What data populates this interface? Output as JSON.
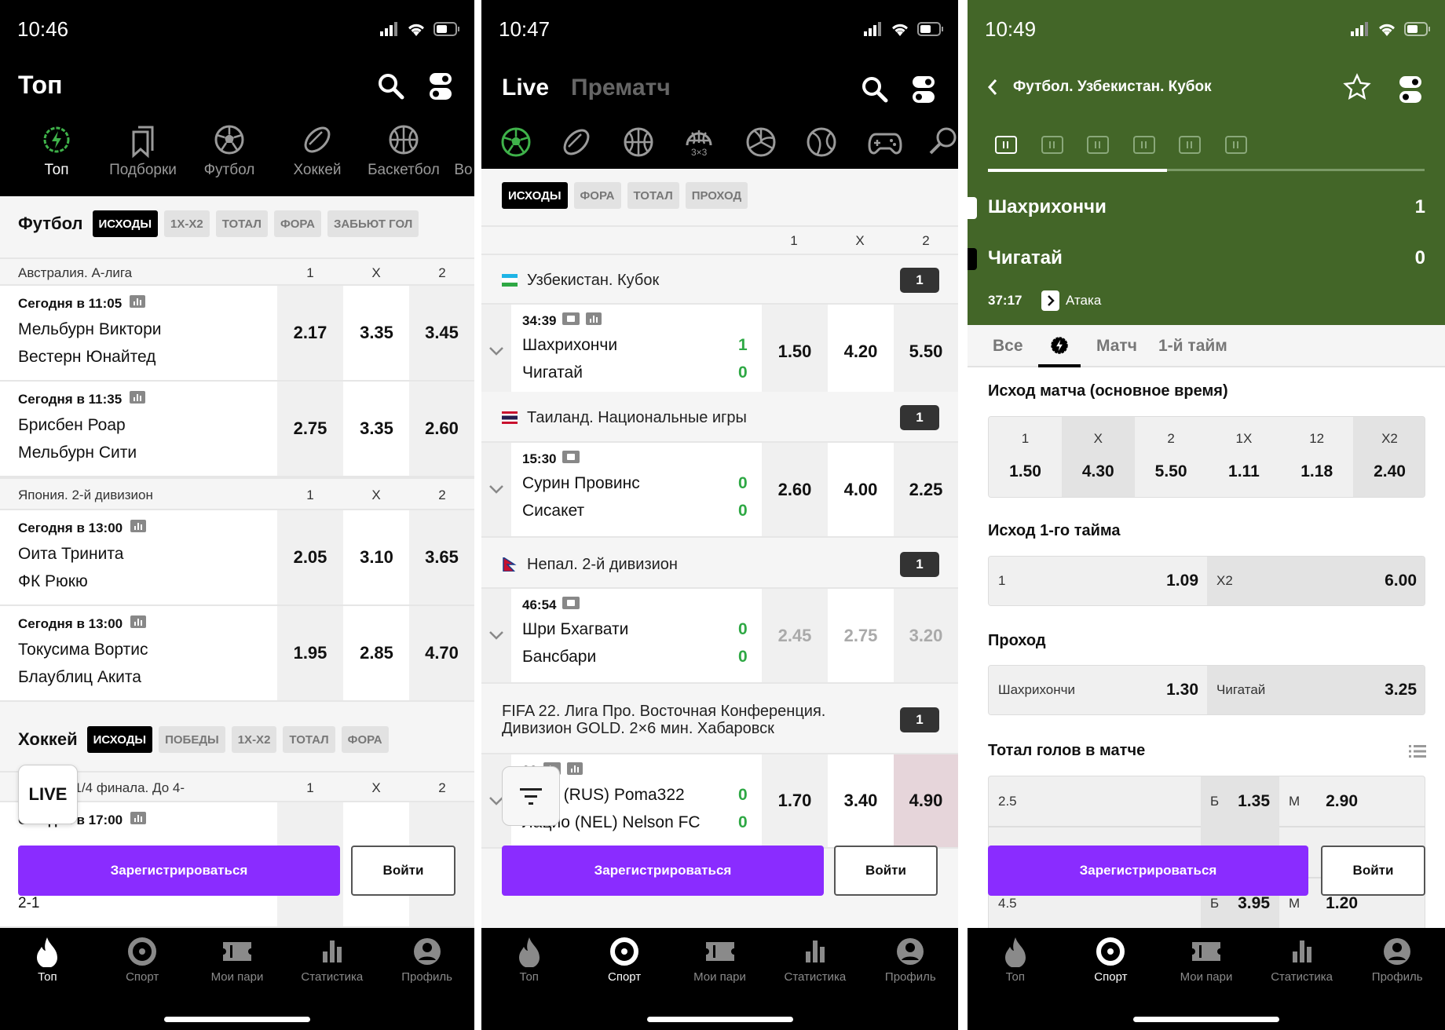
{
  "colors": {
    "accent_green": "#3fb24a",
    "header_green": "#436628",
    "register_purple": "#8a2cff",
    "dark": "#000000",
    "score_green": "#2ea844",
    "suspended_gray": "#aaaaaa",
    "highlight_pink": "#e6d5da"
  },
  "nav": [
    {
      "label": "Топ",
      "icon": "flame-icon"
    },
    {
      "label": "Спорт",
      "icon": "target-icon"
    },
    {
      "label": "Мои пари",
      "icon": "ticket-icon"
    },
    {
      "label": "Статистика",
      "icon": "bar-chart-icon"
    },
    {
      "label": "Профиль",
      "icon": "user-icon"
    }
  ],
  "left": {
    "status_time": "10:46",
    "title": "Топ",
    "categories": [
      {
        "label": "Топ",
        "icon": "lightning-badge-icon",
        "active": true
      },
      {
        "label": "Подборки",
        "icon": "bookmarks-icon"
      },
      {
        "label": "Футбол",
        "icon": "soccer-ball-icon"
      },
      {
        "label": "Хоккей",
        "icon": "hockey-puck-icon"
      },
      {
        "label": "Баскетбол",
        "icon": "basketball-icon"
      },
      {
        "label": "Во",
        "icon": "sport-icon"
      }
    ],
    "football": {
      "title": "Футбол",
      "chips": [
        "ИСХОДЫ",
        "1X-X2",
        "ТОТАЛ",
        "ФОРА",
        "ЗАБЬЮТ ГОЛ"
      ],
      "leagues": [
        {
          "name": "Австралия. А-лига",
          "cols": [
            "1",
            "X",
            "2"
          ],
          "matches": [
            {
              "time": "Сегодня в 11:05",
              "teams": [
                "Мельбурн Виктори",
                "Вестерн Юнайтед"
              ],
              "odds": [
                "2.17",
                "3.35",
                "3.45"
              ]
            },
            {
              "time": "Сегодня в 11:35",
              "teams": [
                "Брисбен Роар",
                "Мельбурн Сити"
              ],
              "odds": [
                "2.75",
                "3.35",
                "2.60"
              ]
            }
          ]
        },
        {
          "name": "Япония. 2-й дивизион",
          "cols": [
            "1",
            "X",
            "2"
          ],
          "matches": [
            {
              "time": "Сегодня в 13:00",
              "teams": [
                "Оита Тринита",
                "ФК Рюкю"
              ],
              "odds": [
                "2.05",
                "3.10",
                "3.65"
              ]
            },
            {
              "time": "Сегодня в 13:00",
              "teams": [
                "Токусима Вортис",
                "Блаублиц Акита"
              ],
              "odds": [
                "1.95",
                "2.85",
                "4.70"
              ]
            }
          ]
        }
      ]
    },
    "hockey": {
      "title": "Хоккей",
      "chips": [
        "ИСХОДЫ",
        "ПОБЕДЫ",
        "1X-X2",
        "ТОТАЛ",
        "ФОРА"
      ],
      "league": "ей-офф. 1/4 финала. До 4-",
      "cols": [
        "1",
        "X",
        "2"
      ],
      "match_time": "Сегодня в 17:00",
      "series_score": "2-1"
    },
    "live_button": "LIVE",
    "register": "Зарегистрироваться",
    "login": "Войти",
    "nav_active": 0
  },
  "middle": {
    "status_time": "10:47",
    "tabs": [
      "Live",
      "Прематч"
    ],
    "sports": [
      "soccer-ball-icon",
      "hockey-puck-icon",
      "basketball-icon",
      "basketball-3x3-icon",
      "volleyball-icon",
      "tennis-icon",
      "gamepad-icon",
      "table-tennis-icon"
    ],
    "sport_3x3": "3×3",
    "chips": [
      "ИСХОДЫ",
      "ФОРА",
      "ТОТАЛ",
      "ПРОХОД"
    ],
    "cols": [
      "1",
      "X",
      "2"
    ],
    "leagues": [
      {
        "name": "Узбекистан. Кубок",
        "flag": "uz",
        "count": "1",
        "match": {
          "time": "34:39",
          "icons": [
            "stadium-icon",
            "stats-icon"
          ],
          "teams": [
            "Шахрихончи",
            "Чигатай"
          ],
          "score": [
            "1",
            "0"
          ],
          "odds": [
            "1.50",
            "4.20",
            "5.50"
          ]
        }
      },
      {
        "name": "Таиланд. Национальные игры",
        "flag": "th",
        "count": "1",
        "match": {
          "time": "15:30",
          "icons": [
            "stadium-icon"
          ],
          "teams": [
            "Сурин Провинс",
            "Сисакет"
          ],
          "score": [
            "0",
            "0"
          ],
          "odds": [
            "2.60",
            "4.00",
            "2.25"
          ]
        }
      },
      {
        "name": "Непал. 2-й дивизион",
        "flag": "np",
        "count": "1",
        "match": {
          "time": "46:54",
          "icons": [
            "stadium-icon"
          ],
          "teams": [
            "Шри Бхагвати",
            "Бансбари"
          ],
          "score": [
            "0",
            "0"
          ],
          "odds": [
            "2.45",
            "2.75",
            "3.20"
          ],
          "suspended": true
        }
      },
      {
        "name": "FIFA 22. Лига Про. Восточная Конференция. Дивизион GOLD. 2×6 мин. Хабаровск",
        "flag": "",
        "count": "1",
        "match": {
          "time": "00",
          "icons": [
            "play-icon",
            "stats-icon"
          ],
          "teams": [
            "Бойз (RUS) Poma322",
            "Лацио (NEL) Nelson FC"
          ],
          "score": [
            "0",
            "0"
          ],
          "odds": [
            "1.70",
            "3.40",
            "4.90"
          ],
          "highlight": 2
        }
      }
    ],
    "register": "Зарегистрироваться",
    "login": "Войти",
    "nav_active": 1
  },
  "right": {
    "status_time": "10:49",
    "title": "Футбол. Узбекистан. Кубок",
    "info_tabs": [
      "info-icon",
      "stats-icon",
      "field-icon",
      "lineup-icon",
      "stats-icon",
      "e-icon"
    ],
    "info_progress": 0.41,
    "teams": [
      {
        "name": "Шахрихончи",
        "score": "1"
      },
      {
        "name": "Чигатай",
        "score": "0"
      }
    ],
    "match_time": "37:17",
    "event": "Атака",
    "tabs": [
      "Все",
      "",
      "Матч",
      "1-й тайм"
    ],
    "markets": {
      "outcome": {
        "title": "Исход матча (основное время)",
        "labels": [
          "1",
          "X",
          "2",
          "1X",
          "12",
          "X2"
        ],
        "odds": [
          "1.50",
          "4.30",
          "5.50",
          "1.11",
          "1.18",
          "2.40"
        ]
      },
      "first_half": {
        "title": "Исход 1-го тайма",
        "items": [
          {
            "label": "1",
            "odd": "1.09"
          },
          {
            "label": "X2",
            "odd": "6.00"
          }
        ]
      },
      "pass": {
        "title": "Проход",
        "items": [
          {
            "label": "Шахрихончи",
            "odd": "1.30"
          },
          {
            "label": "Чигатай",
            "odd": "3.25"
          }
        ]
      },
      "total": {
        "title": "Тотал голов в матче",
        "over": "Б",
        "under": "М",
        "rows": [
          {
            "line": "2.5",
            "over": "1.35",
            "under": "2.90"
          },
          {
            "line": "",
            "over": "",
            "under": ""
          },
          {
            "line": "4.5",
            "over": "3.95",
            "under": "1.20"
          }
        ]
      }
    },
    "register": "Зарегистрироваться",
    "login": "Войти",
    "nav_active": 1
  }
}
